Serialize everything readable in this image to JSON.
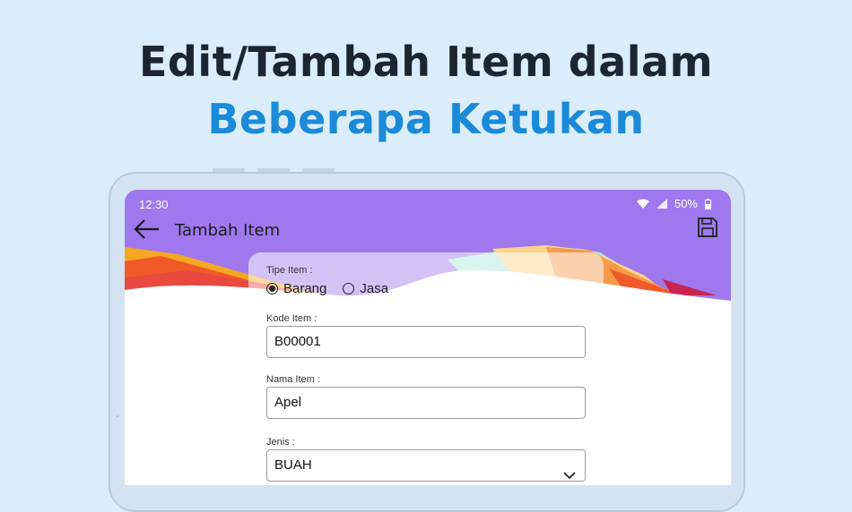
{
  "headline": {
    "line1": "Edit/Tambah Item dalam",
    "line2": "Beberapa Ketukan"
  },
  "status_bar": {
    "time": "12:30",
    "battery": "50%"
  },
  "app_bar": {
    "title": "Tambah Item",
    "back_icon": "arrow-left-icon",
    "save_icon": "floppy-disk-icon"
  },
  "form": {
    "tipe_item": {
      "label": "Tipe Item :",
      "options": [
        "Barang",
        "Jasa"
      ],
      "selected": "Barang"
    },
    "kode_item": {
      "label": "Kode Item :",
      "value": "B00001"
    },
    "nama_item": {
      "label": "Nama Item :",
      "value": "Apel"
    },
    "jenis": {
      "label": "Jenis :",
      "value": "BUAH"
    }
  },
  "colors": {
    "background": "#dbedfb",
    "headline_dark": "#1b2630",
    "headline_accent": "#1b8ad8",
    "app_bar_purple": "#9f78ee",
    "wave_orange": "#f5a623",
    "wave_red": "#f05a28",
    "wave_mint": "#a8e6d6"
  }
}
